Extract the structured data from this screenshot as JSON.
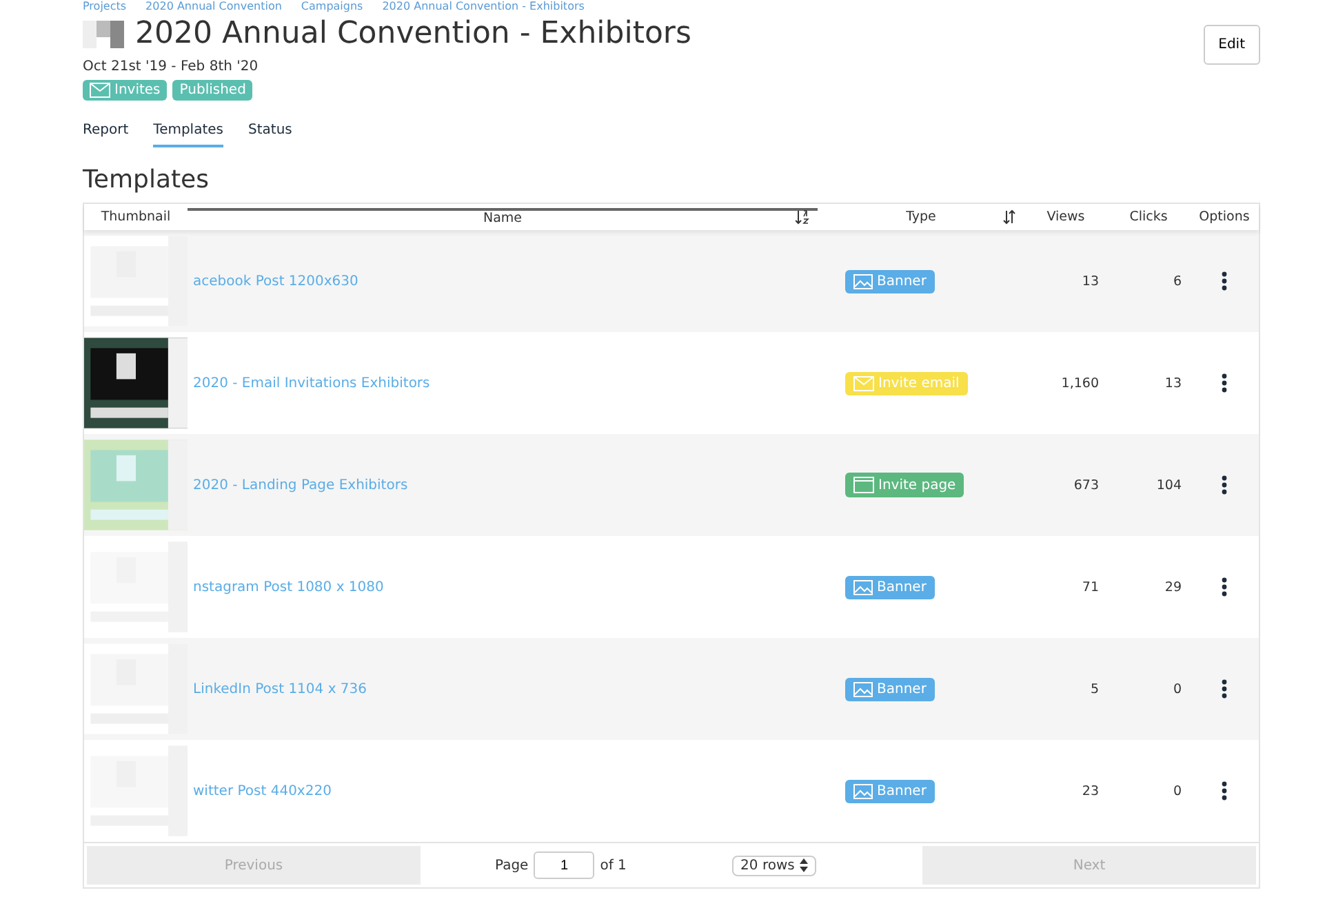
{
  "breadcrumb": [
    "Projects",
    "2020 Annual Convention",
    "Campaigns",
    "2020 Annual Convention - Exhibitors"
  ],
  "title": "2020 Annual Convention - Exhibitors",
  "dates": "Oct 21st '19 - Feb 8th '20",
  "edit_button": "Edit",
  "badges": [
    {
      "label": "Invites",
      "kind": "mail"
    },
    {
      "label": "Published",
      "kind": "plain"
    }
  ],
  "tabs": [
    {
      "label": "Report",
      "selected": false
    },
    {
      "label": "Templates",
      "selected": true
    },
    {
      "label": "Status",
      "selected": false
    }
  ],
  "section_title": "Templates",
  "table": {
    "columns": [
      "Thumbnail",
      "Name",
      "Type",
      "Views",
      "Clicks",
      "Options"
    ],
    "rows": [
      {
        "name": "acebook Post 1200x630",
        "type": {
          "label": "Banner",
          "kind": "banner"
        },
        "views": "13",
        "clicks": "6"
      },
      {
        "name": "2020 - Email Invitations Exhibitors",
        "type": {
          "label": "Invite email",
          "kind": "email"
        },
        "views": "1,160",
        "clicks": "13"
      },
      {
        "name": "2020 - Landing Page Exhibitors",
        "type": {
          "label": "Invite page",
          "kind": "page"
        },
        "views": "673",
        "clicks": "104"
      },
      {
        "name": "nstagram Post 1080 x 1080",
        "type": {
          "label": "Banner",
          "kind": "banner"
        },
        "views": "71",
        "clicks": "29"
      },
      {
        "name": "LinkedIn Post 1104 x 736",
        "type": {
          "label": "Banner",
          "kind": "banner"
        },
        "views": "5",
        "clicks": "0"
      },
      {
        "name": "witter Post 440x220",
        "type": {
          "label": "Banner",
          "kind": "banner"
        },
        "views": "23",
        "clicks": "0"
      }
    ]
  },
  "pagination": {
    "previous": "Previous",
    "page_label": "Page",
    "page": "1",
    "of": "of 1",
    "rows": "20 rows",
    "next": "Next"
  }
}
